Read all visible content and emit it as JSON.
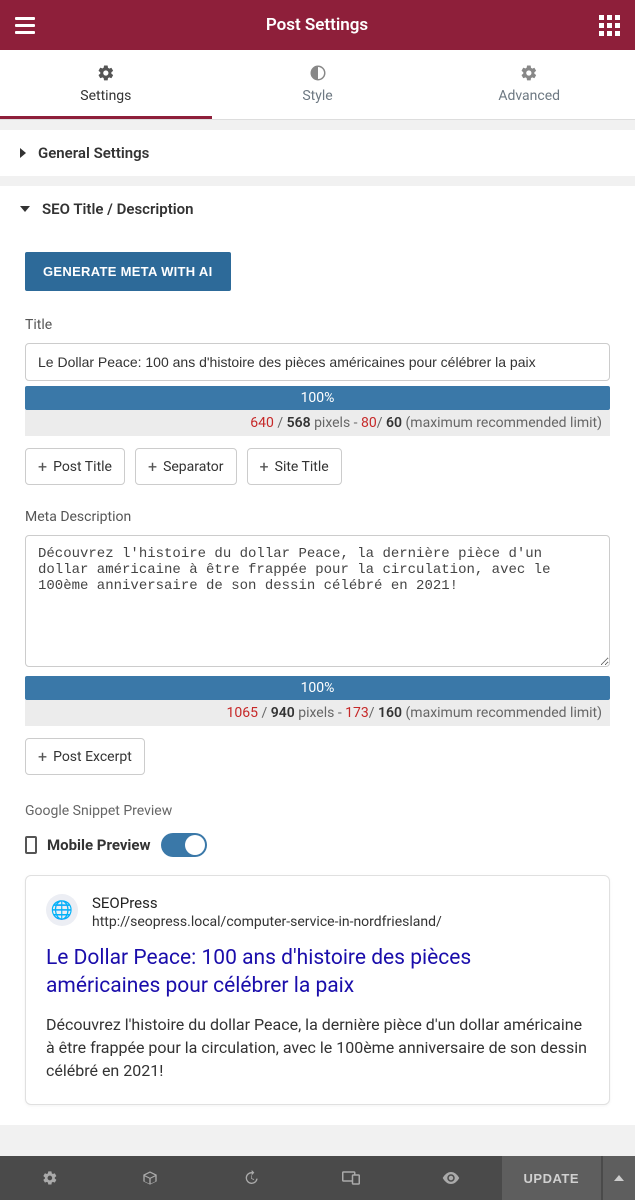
{
  "header": {
    "title": "Post Settings"
  },
  "tabs": {
    "settings": "Settings",
    "style": "Style",
    "advanced": "Advanced"
  },
  "sections": {
    "general": "General Settings",
    "seo": "SEO Title / Description"
  },
  "seo": {
    "generate_btn": "GENERATE META WITH AI",
    "title_label": "Title",
    "title_value": "Le Dollar Peace: 100 ans d'histoire des pièces américaines pour célébrer la paix",
    "title_progress": "100%",
    "title_px_actual": "640",
    "title_px_rec": "568",
    "title_ch_actual": "80",
    "title_ch_rec": "60",
    "pixels_word": "pixels",
    "limit_text": "(maximum recommended limit)",
    "chips": {
      "post_title": "Post Title",
      "separator": "Separator",
      "site_title": "Site Title"
    },
    "meta_label": "Meta Description",
    "meta_value": "Découvrez l'histoire du dollar Peace, la dernière pièce d'un dollar américaine à être frappée pour la circulation, avec le 100ème anniversaire de son dessin célébré en 2021!",
    "meta_progress": "100%",
    "meta_px_actual": "1065",
    "meta_px_rec": "940",
    "meta_ch_actual": "173",
    "meta_ch_rec": "160",
    "excerpt_chip": "Post Excerpt",
    "snippet_heading": "Google Snippet Preview",
    "mobile_label": "Mobile Preview",
    "snippet": {
      "site": "SEOPress",
      "url": "http://seopress.local/computer-service-in-nordfriesland/",
      "title": "Le Dollar Peace: 100 ans d'histoire des pièces américaines pour célébrer la paix",
      "desc": "Découvrez l'histoire du dollar Peace, la dernière pièce d'un dollar américaine à être frappée pour la circulation, avec le 100ème anniversaire de son dessin célébré en 2021!"
    }
  },
  "footer": {
    "update": "UPDATE"
  }
}
